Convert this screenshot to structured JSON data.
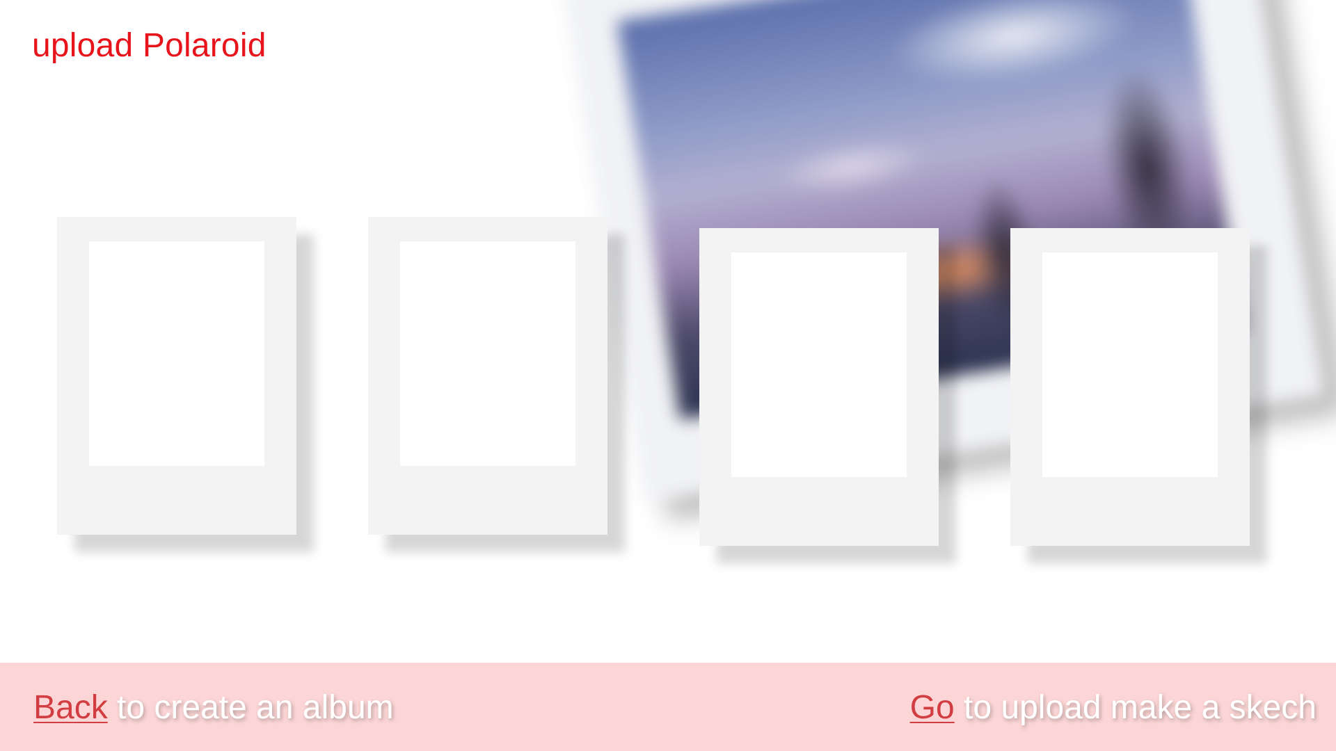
{
  "page": {
    "title": "upload Polaroid"
  },
  "polaroid_slots": [
    {
      "label": "polaroid-slot-1"
    },
    {
      "label": "polaroid-slot-2"
    },
    {
      "label": "polaroid-slot-3"
    },
    {
      "label": "polaroid-slot-4"
    }
  ],
  "footer": {
    "back_link": "Back",
    "back_text": " to create an album",
    "go_link": "Go",
    "go_text": " to upload make a skech"
  },
  "colors": {
    "title": "#e8141b",
    "link": "#d23d41",
    "footer_background": "#fcd6d6",
    "slot_frame": "#f3f3f3",
    "slot_photo": "#ffffff"
  }
}
